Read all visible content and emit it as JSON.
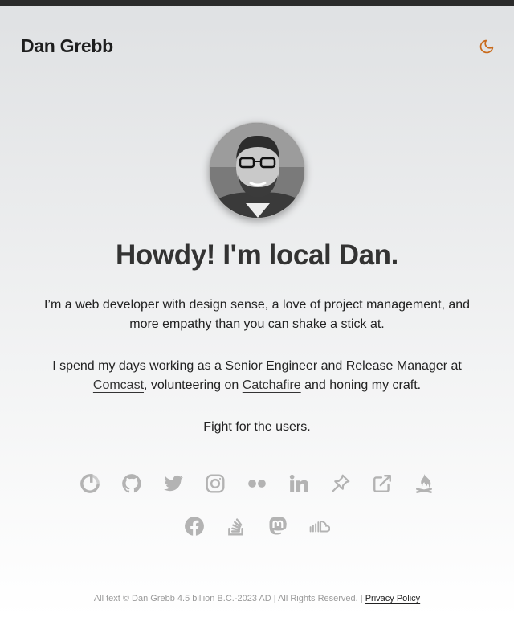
{
  "header": {
    "site_title": "Dan Grebb",
    "theme_toggle_icon": "moon-icon",
    "accent_color": "#c96a1b"
  },
  "hero": {
    "avatar_icon": "profile-photo",
    "headline": "Howdy! I'm local Dan.",
    "intro": "I’m a web developer with design sense, a love of project management, and more empathy than you can shake a stick at.",
    "work_prefix": "I spend my days working as a Senior Engineer and Release Manager at ",
    "work_link_1": "Comcast",
    "work_middle": ", volunteering on ",
    "work_link_2": "Catchafire",
    "work_suffix": " and honing my craft.",
    "motto": "Fight for the users."
  },
  "social": {
    "row1": [
      "gravatar-icon",
      "github-icon",
      "twitter-icon",
      "instagram-icon",
      "flickr-icon",
      "linkedin-icon",
      "pinboard-icon",
      "external-link-icon",
      "campfire-icon"
    ],
    "row2": [
      "facebook-icon",
      "stack-overflow-icon",
      "mastodon-icon",
      "soundcloud-icon"
    ],
    "icon_color": "#b3b3b3"
  },
  "footer": {
    "copyright": "All text © Dan Grebb 4.5 billion B.C.-2023 AD | All Rights Reserved. | ",
    "privacy_link": "Privacy Policy"
  }
}
